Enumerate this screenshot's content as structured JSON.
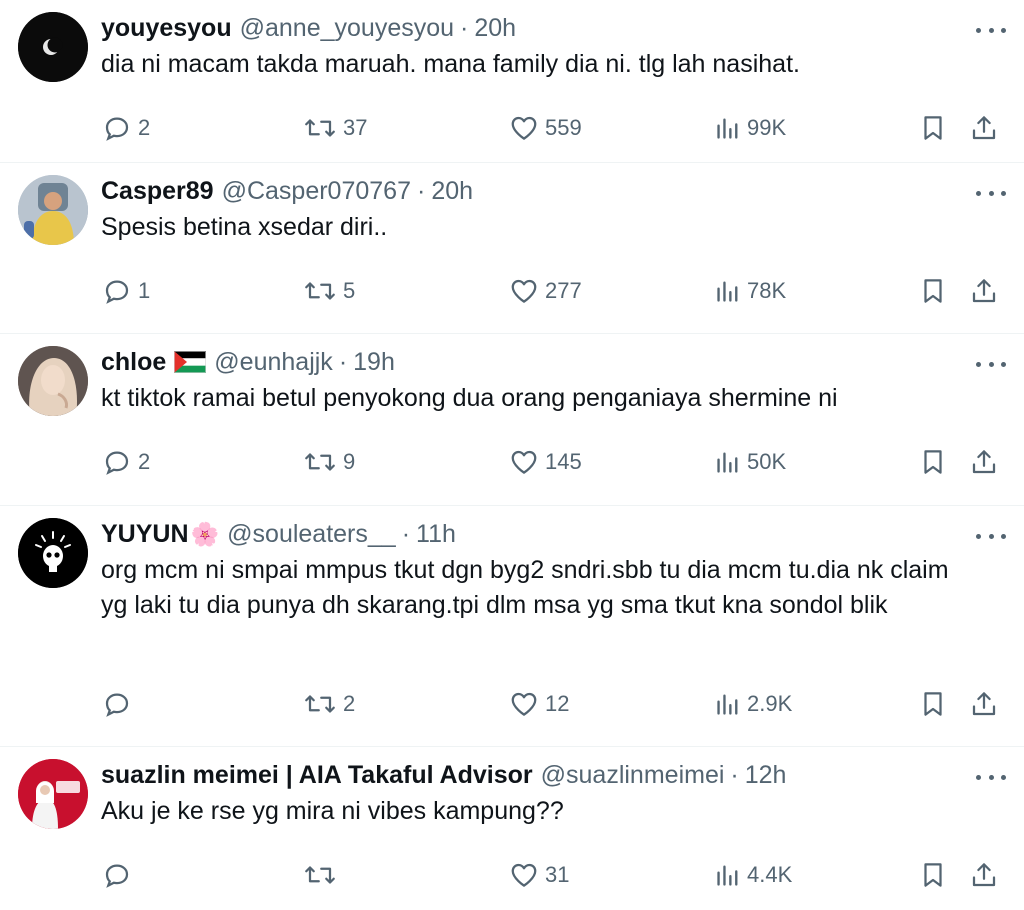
{
  "colors": {
    "text": "#0f1419",
    "secondary": "#536471",
    "divider": "#eff3f4"
  },
  "tweets": [
    {
      "name": "youyesyou",
      "handle": "@anne_youyesyou",
      "sep": "·",
      "time": "20h",
      "text": "dia ni macam takda maruah. mana family dia ni. tlg lah nasihat.",
      "replies": "2",
      "retweets": "37",
      "likes": "559",
      "views": "99K",
      "avatar": "moon-avatar"
    },
    {
      "name": "Casper89",
      "handle": "@Casper070767",
      "sep": "·",
      "time": "20h",
      "text": "Spesis betina xsedar diri..",
      "replies": "1",
      "retweets": "5",
      "likes": "277",
      "views": "78K",
      "avatar": "photo-avatar"
    },
    {
      "name": "chloe",
      "handle": "@eunhajjk",
      "sep": "·",
      "time": "19h",
      "text": "kt tiktok ramai betul penyokong dua orang penganiaya shermine ni",
      "replies": "2",
      "retweets": "9",
      "likes": "145",
      "views": "50K",
      "avatar": "photo-avatar",
      "flag": "palestine-flag"
    },
    {
      "name": "YUYUN",
      "handle": "@souleaters__",
      "sep": "·",
      "time": "11h",
      "text": "org mcm ni smpai mmpus tkut dgn byg2 sndri.sbb tu dia mcm tu.dia nk claim yg laki tu dia punya dh skarang.tpi dlm msa yg sma tkut kna sondol blik",
      "replies": "",
      "retweets": "2",
      "likes": "12",
      "views": "2.9K",
      "avatar": "skull-avatar",
      "emoji": "🌸"
    },
    {
      "name": "suazlin meimei | AIA Takaful Advisor",
      "handle": "@suazlinmeimei",
      "sep": "·",
      "time": "12h",
      "text": "Aku je ke rse yg mira ni vibes kampung??",
      "replies": "",
      "retweets": "",
      "likes": "31",
      "views": "4.4K",
      "avatar": "aia-avatar"
    }
  ]
}
